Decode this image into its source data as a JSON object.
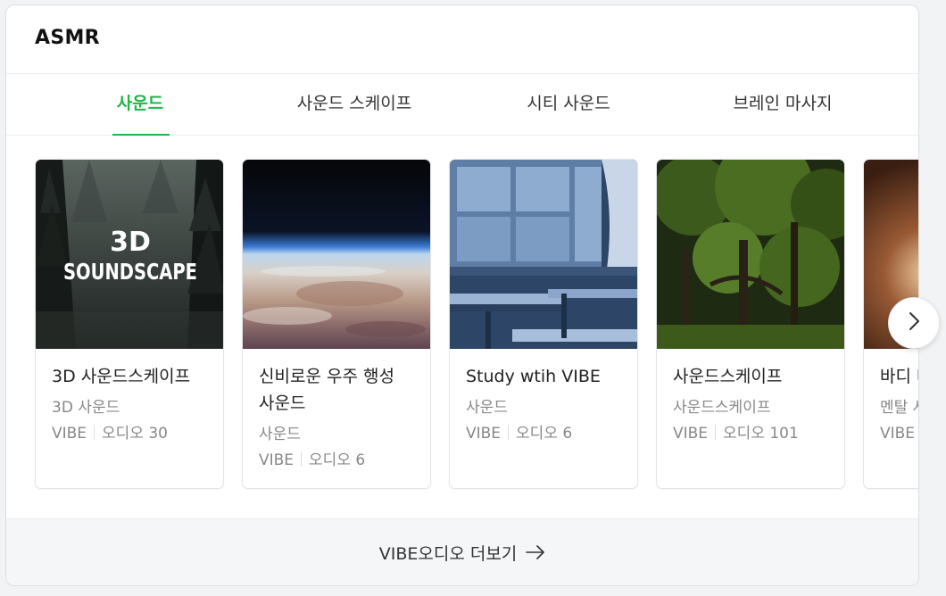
{
  "section": {
    "title": "ASMR"
  },
  "tabs": [
    {
      "label": "사운드",
      "active": true
    },
    {
      "label": "사운드 스케이프",
      "active": false
    },
    {
      "label": "시티 사운드",
      "active": false
    },
    {
      "label": "브레인 마사지",
      "active": false
    }
  ],
  "cards": [
    {
      "title": "3D 사운드스케이프",
      "category": "3D 사운드",
      "source": "VIBE",
      "count": "오디오 30",
      "thumb_text_1": "3D",
      "thumb_text_2": "SOUNDSCAPE"
    },
    {
      "title": "신비로운 우주 행성 사운드",
      "category": "사운드",
      "source": "VIBE",
      "count": "오디오 6"
    },
    {
      "title": "Study wtih VIBE",
      "category": "사운드",
      "source": "VIBE",
      "count": "오디오 6"
    },
    {
      "title": "사운드스케이프",
      "category": "사운드스케이프",
      "source": "VIBE",
      "count": "오디오 101"
    },
    {
      "title": "바디 마사지",
      "category": "멘탈 사운드",
      "source": "VIBE",
      "count": ""
    }
  ],
  "footer": {
    "label": "VIBE오디오 더보기"
  },
  "icons": {
    "next": "chevron-right-icon",
    "more": "arrow-right-icon"
  },
  "colors": {
    "accent": "#1fb64a"
  }
}
